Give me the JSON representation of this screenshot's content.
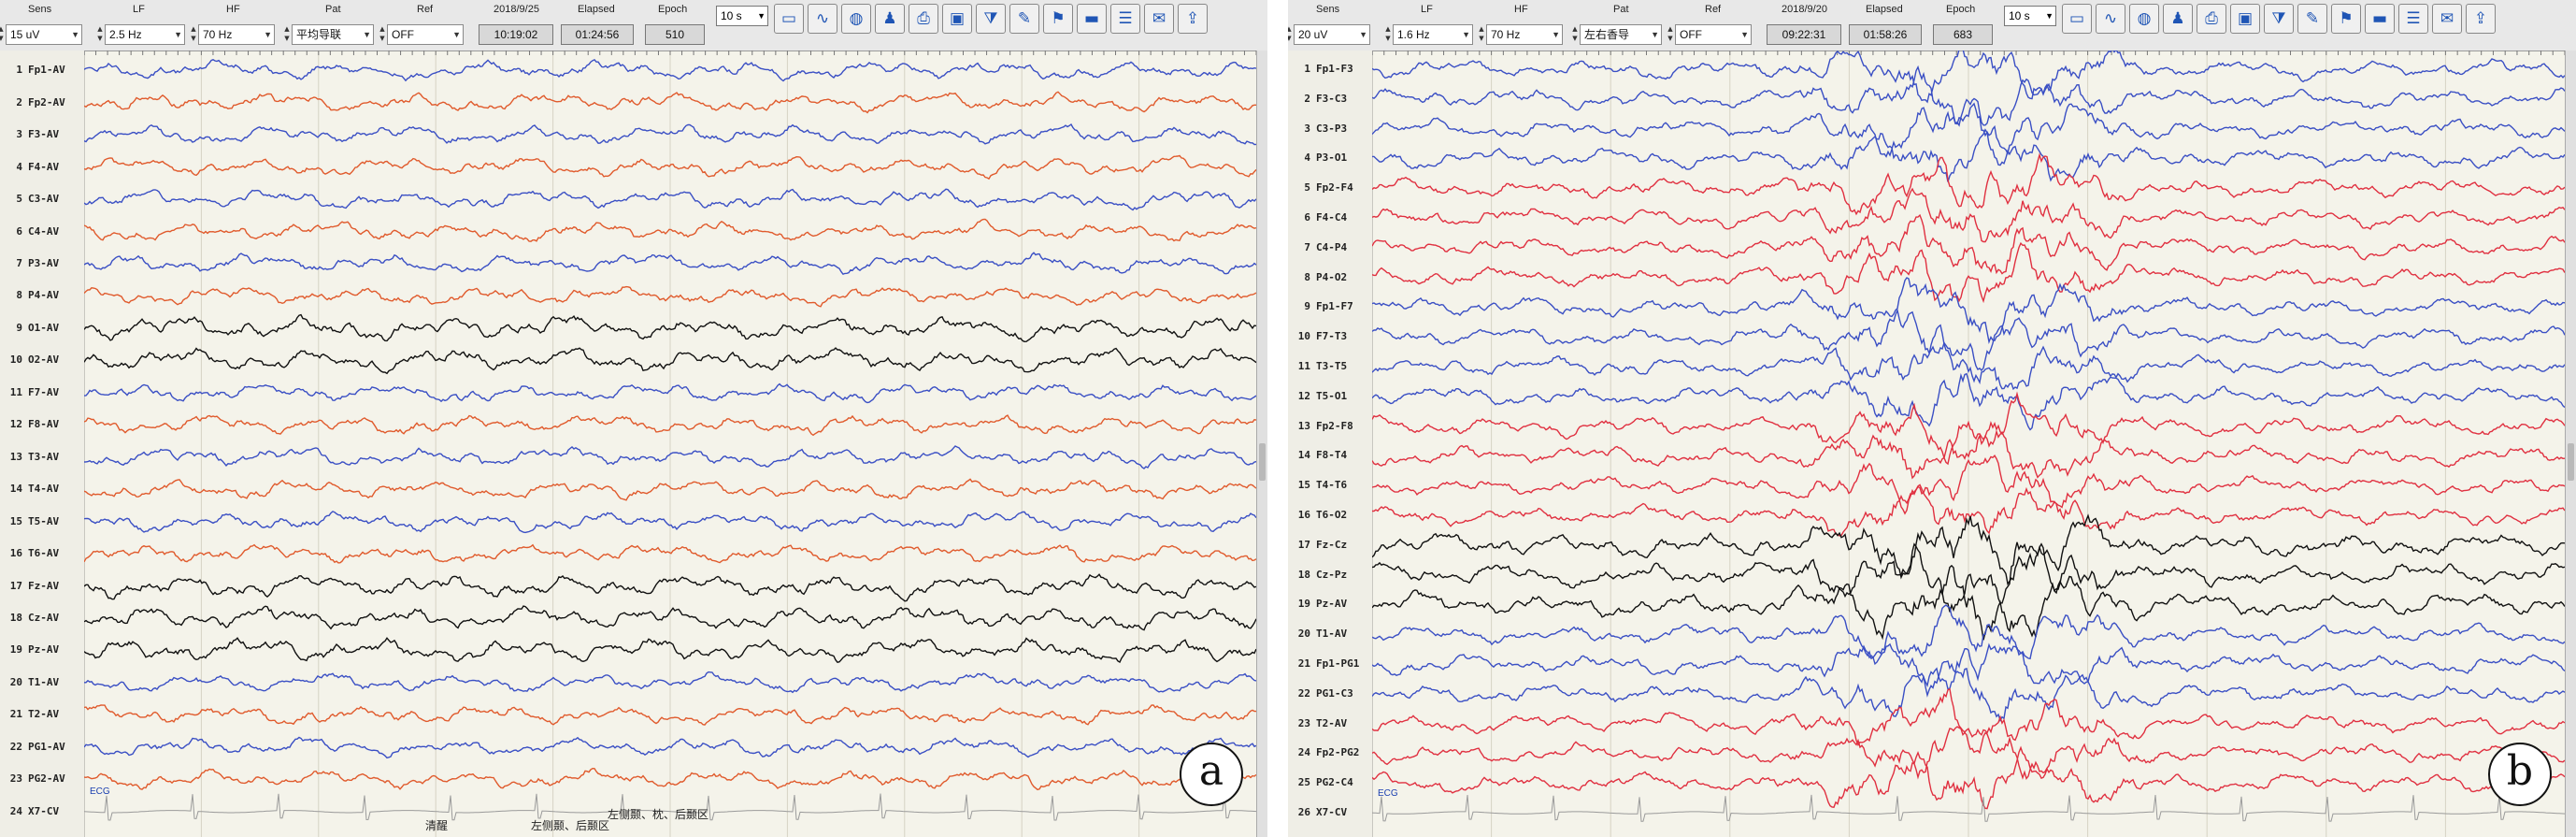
{
  "panels": [
    {
      "id": "a",
      "letter": "a",
      "toolbar": {
        "sens_label": "Sens",
        "sens_value": "15 uV",
        "lf_label": "LF",
        "lf_value": "2.5 Hz",
        "hf_label": "HF",
        "hf_value": "70 Hz",
        "pat_label": "Pat",
        "pat_value": "平均导联",
        "ref_label": "Ref",
        "ref_value": "OFF",
        "date": "2018/9/25",
        "time": "10:19:02",
        "elapsed_label": "Elapsed",
        "elapsed_value": "01:24:56",
        "epoch_label": "Epoch",
        "epoch_value": "510",
        "sweep_value": "10 s"
      },
      "channels": [
        {
          "num": "1",
          "name": "Fp1-AV",
          "color": "#3a4fc4"
        },
        {
          "num": "2",
          "name": "Fp2-AV",
          "color": "#e05a2c"
        },
        {
          "num": "3",
          "name": "F3-AV",
          "color": "#3a4fc4"
        },
        {
          "num": "4",
          "name": "F4-AV",
          "color": "#e05a2c"
        },
        {
          "num": "5",
          "name": "C3-AV",
          "color": "#3a4fc4"
        },
        {
          "num": "6",
          "name": "C4-AV",
          "color": "#e05a2c"
        },
        {
          "num": "7",
          "name": "P3-AV",
          "color": "#3a4fc4"
        },
        {
          "num": "8",
          "name": "P4-AV",
          "color": "#e05a2c"
        },
        {
          "num": "9",
          "name": "O1-AV",
          "color": "#111111"
        },
        {
          "num": "10",
          "name": "O2-AV",
          "color": "#111111"
        },
        {
          "num": "11",
          "name": "F7-AV",
          "color": "#3a4fc4"
        },
        {
          "num": "12",
          "name": "F8-AV",
          "color": "#e05a2c"
        },
        {
          "num": "13",
          "name": "T3-AV",
          "color": "#3a4fc4"
        },
        {
          "num": "14",
          "name": "T4-AV",
          "color": "#e05a2c"
        },
        {
          "num": "15",
          "name": "T5-AV",
          "color": "#3a4fc4"
        },
        {
          "num": "16",
          "name": "T6-AV",
          "color": "#e05a2c"
        },
        {
          "num": "17",
          "name": "Fz-AV",
          "color": "#111111"
        },
        {
          "num": "18",
          "name": "Cz-AV",
          "color": "#111111"
        },
        {
          "num": "19",
          "name": "Pz-AV",
          "color": "#111111"
        },
        {
          "num": "20",
          "name": "T1-AV",
          "color": "#3a4fc4"
        },
        {
          "num": "21",
          "name": "T2-AV",
          "color": "#e05a2c"
        },
        {
          "num": "22",
          "name": "PG1-AV",
          "color": "#3a4fc4"
        },
        {
          "num": "23",
          "name": "PG2-AV",
          "color": "#e05a2c"
        },
        {
          "num": "24",
          "name": "X7-CV",
          "color": "#9a9a9a"
        }
      ],
      "ecg_label": "ECG",
      "annotations": [
        "清醒",
        "左侧颞、枕、后颞区",
        "左侧颞、后颞区"
      ]
    },
    {
      "id": "b",
      "letter": "b",
      "toolbar": {
        "sens_label": "Sens",
        "sens_value": "20 uV",
        "lf_label": "LF",
        "lf_value": "1.6 Hz",
        "hf_label": "HF",
        "hf_value": "70 Hz",
        "pat_label": "Pat",
        "pat_value": "左右香导",
        "ref_label": "Ref",
        "ref_value": "OFF",
        "date": "2018/9/20",
        "time": "09:22:31",
        "elapsed_label": "Elapsed",
        "elapsed_value": "01:58:26",
        "epoch_label": "Epoch",
        "epoch_value": "683",
        "sweep_value": "10 s"
      },
      "channels": [
        {
          "num": "1",
          "name": "Fp1-F3",
          "color": "#3a4fc4"
        },
        {
          "num": "2",
          "name": "F3-C3",
          "color": "#3a4fc4"
        },
        {
          "num": "3",
          "name": "C3-P3",
          "color": "#3a4fc4"
        },
        {
          "num": "4",
          "name": "P3-O1",
          "color": "#3a4fc4"
        },
        {
          "num": "5",
          "name": "Fp2-F4",
          "color": "#e03040"
        },
        {
          "num": "6",
          "name": "F4-C4",
          "color": "#e03040"
        },
        {
          "num": "7",
          "name": "C4-P4",
          "color": "#e03040"
        },
        {
          "num": "8",
          "name": "P4-O2",
          "color": "#e03040"
        },
        {
          "num": "9",
          "name": "Fp1-F7",
          "color": "#3a4fc4"
        },
        {
          "num": "10",
          "name": "F7-T3",
          "color": "#3a4fc4"
        },
        {
          "num": "11",
          "name": "T3-T5",
          "color": "#3a4fc4"
        },
        {
          "num": "12",
          "name": "T5-O1",
          "color": "#3a4fc4"
        },
        {
          "num": "13",
          "name": "Fp2-F8",
          "color": "#e03040"
        },
        {
          "num": "14",
          "name": "F8-T4",
          "color": "#e03040"
        },
        {
          "num": "15",
          "name": "T4-T6",
          "color": "#e03040"
        },
        {
          "num": "16",
          "name": "T6-O2",
          "color": "#e03040"
        },
        {
          "num": "17",
          "name": "Fz-Cz",
          "color": "#111111"
        },
        {
          "num": "18",
          "name": "Cz-Pz",
          "color": "#111111"
        },
        {
          "num": "19",
          "name": "Pz-AV",
          "color": "#111111"
        },
        {
          "num": "20",
          "name": "T1-AV",
          "color": "#3a4fc4"
        },
        {
          "num": "21",
          "name": "Fp1-PG1",
          "color": "#3a4fc4"
        },
        {
          "num": "22",
          "name": "PG1-C3",
          "color": "#3a4fc4"
        },
        {
          "num": "23",
          "name": "T2-AV",
          "color": "#e03040"
        },
        {
          "num": "24",
          "name": "Fp2-PG2",
          "color": "#e03040"
        },
        {
          "num": "25",
          "name": "PG2-C4",
          "color": "#e03040"
        },
        {
          "num": "26",
          "name": "X7-CV",
          "color": "#9a9a9a"
        }
      ],
      "ecg_label": "ECG",
      "annotations": []
    }
  ],
  "toolbar_icons": [
    "folder-icon",
    "chart-icon",
    "globe-icon",
    "person-icon",
    "printer-icon",
    "save-icon",
    "filter-icon",
    "edit-icon",
    "marker-icon",
    "ruler-icon",
    "montage-icon",
    "note-icon",
    "export-icon"
  ]
}
